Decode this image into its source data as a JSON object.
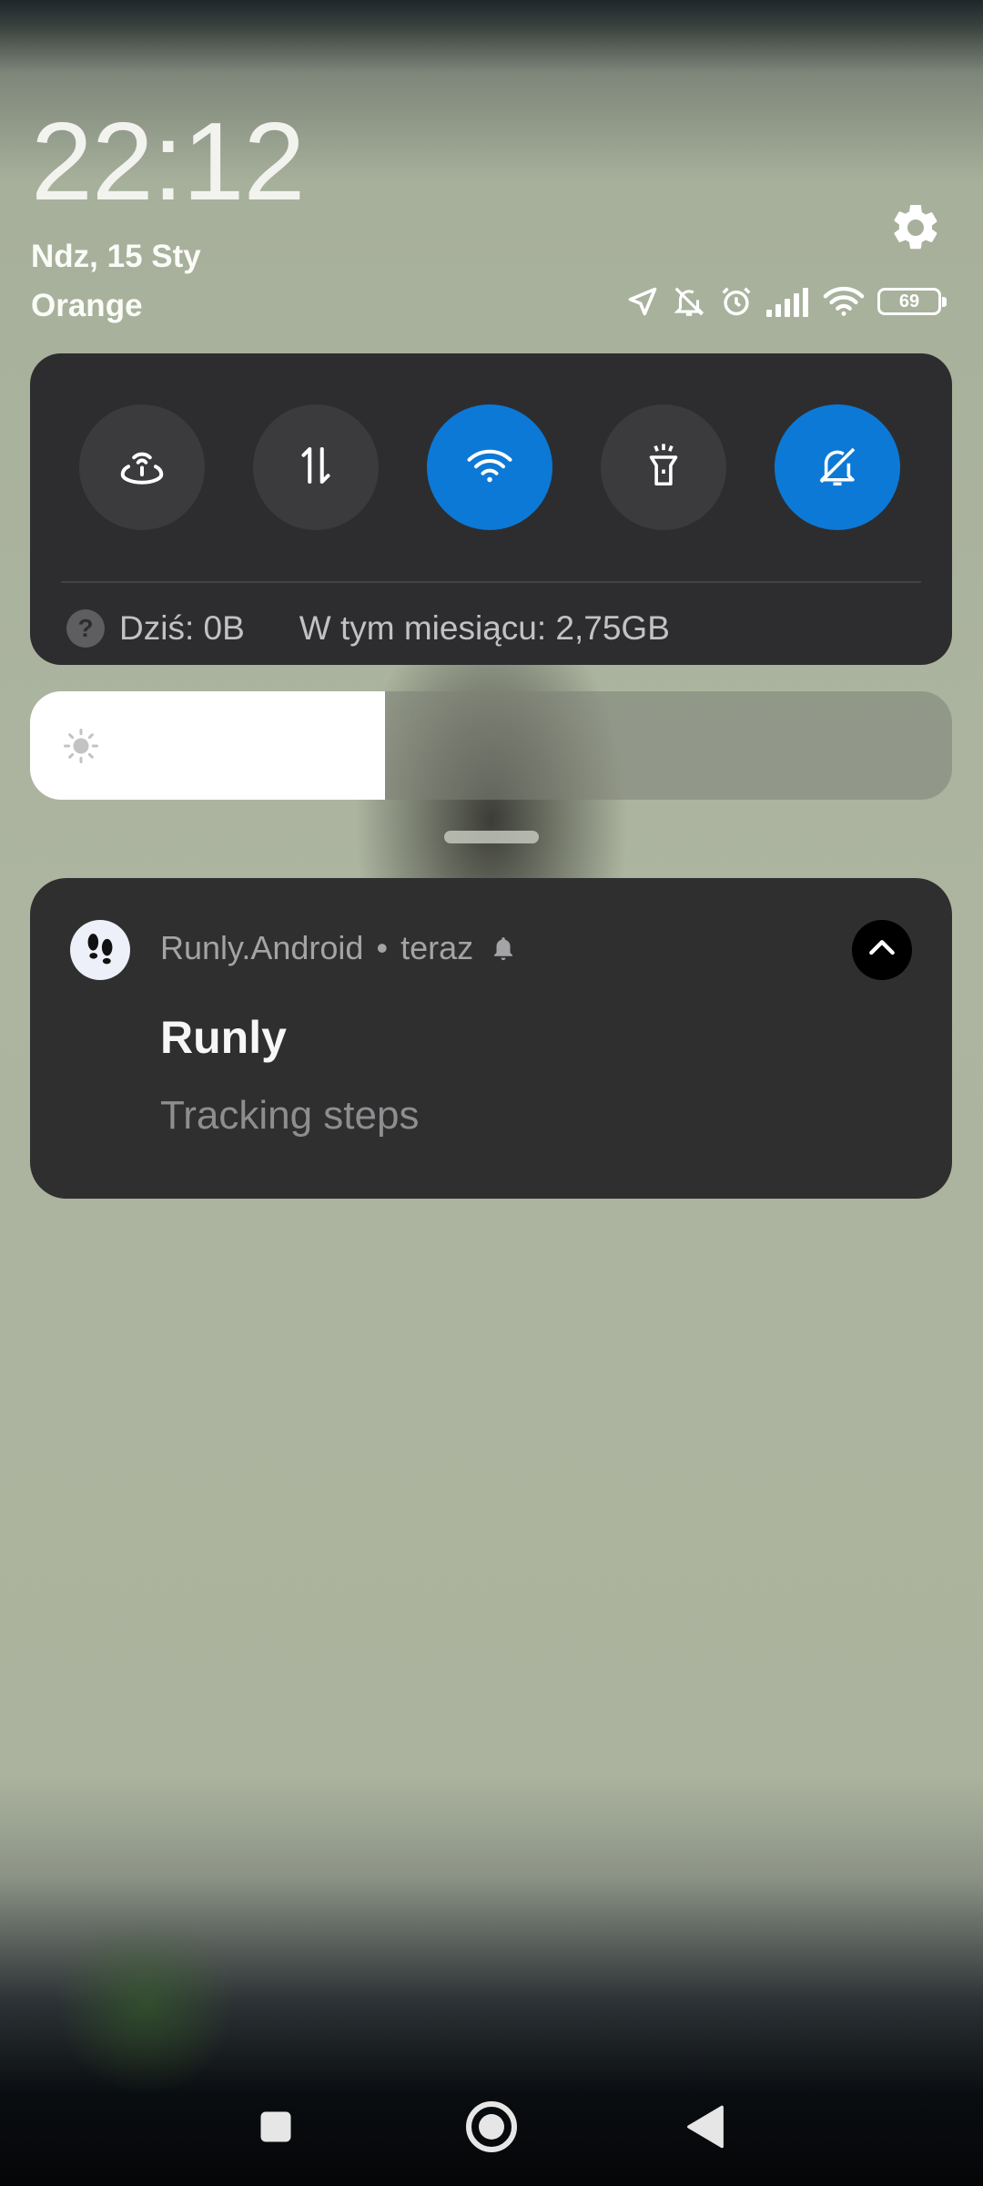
{
  "header": {
    "time": "22:12",
    "date": "Ndz, 15 Sty",
    "carrier": "Orange",
    "battery_level": "69"
  },
  "status_icons": [
    "location-icon",
    "notifications-off-icon",
    "alarm-icon",
    "signal-icon",
    "wifi-icon",
    "battery-icon"
  ],
  "quick_settings": {
    "tiles": [
      {
        "name": "hotspot",
        "icon": "hotspot-icon",
        "active": false
      },
      {
        "name": "mobile-data",
        "icon": "data-arrows-icon",
        "active": false
      },
      {
        "name": "wifi",
        "icon": "wifi-icon",
        "active": true
      },
      {
        "name": "flashlight",
        "icon": "flashlight-icon",
        "active": false
      },
      {
        "name": "mute",
        "icon": "bell-off-icon",
        "active": true
      }
    ],
    "data_usage": {
      "today": "Dziś: 0B",
      "month": "W tym miesiącu: 2,75GB"
    }
  },
  "brightness": {
    "level": 0.385
  },
  "notification": {
    "app_name": "Runly.Android",
    "time": "teraz",
    "title": "Runly",
    "text": "Tracking steps"
  },
  "colors": {
    "accent": "#0c79d6",
    "panel": "#2d2d2f",
    "wallpaper": "#abb39e"
  },
  "navbar": {
    "buttons": [
      "recents-icon",
      "home-icon",
      "back-icon"
    ]
  }
}
